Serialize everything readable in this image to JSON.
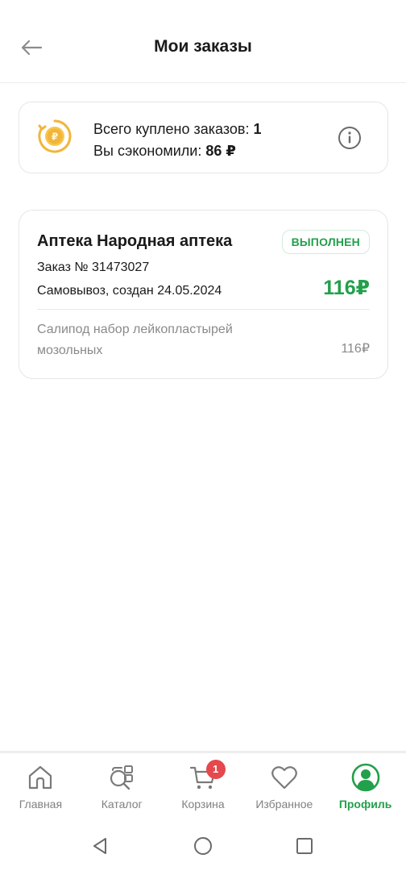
{
  "header": {
    "title": "Мои заказы",
    "back_icon": "arrow-left-icon"
  },
  "stats": {
    "orders_label": "Всего куплено заказов:",
    "orders_count": "1",
    "saved_label": "Вы сэкономили:",
    "saved_amount": "86 ₽",
    "coin_icon": "ruble-coin-icon",
    "info_icon": "info-icon"
  },
  "orders": [
    {
      "pharmacy": "Аптека Народная аптека",
      "status": "ВЫПОЛНЕН",
      "number": "Заказ № 31473027",
      "meta": "Самовывоз, создан 24.05.2024",
      "total": "116₽",
      "items": [
        {
          "name": "Салипод набор лейкопластырей мозольных",
          "price": "116₽"
        }
      ]
    }
  ],
  "nav": {
    "items": [
      {
        "label": "Главная",
        "icon": "home-icon",
        "active": false
      },
      {
        "label": "Каталог",
        "icon": "catalog-icon",
        "active": false
      },
      {
        "label": "Корзина",
        "icon": "cart-icon",
        "active": false,
        "badge": "1"
      },
      {
        "label": "Избранное",
        "icon": "heart-icon",
        "active": false
      },
      {
        "label": "Профиль",
        "icon": "profile-icon",
        "active": true
      }
    ]
  },
  "colors": {
    "accent": "#22a04b",
    "badge": "#e5484d",
    "muted_text": "#8a8a8a",
    "coin": "#f2b53a"
  }
}
